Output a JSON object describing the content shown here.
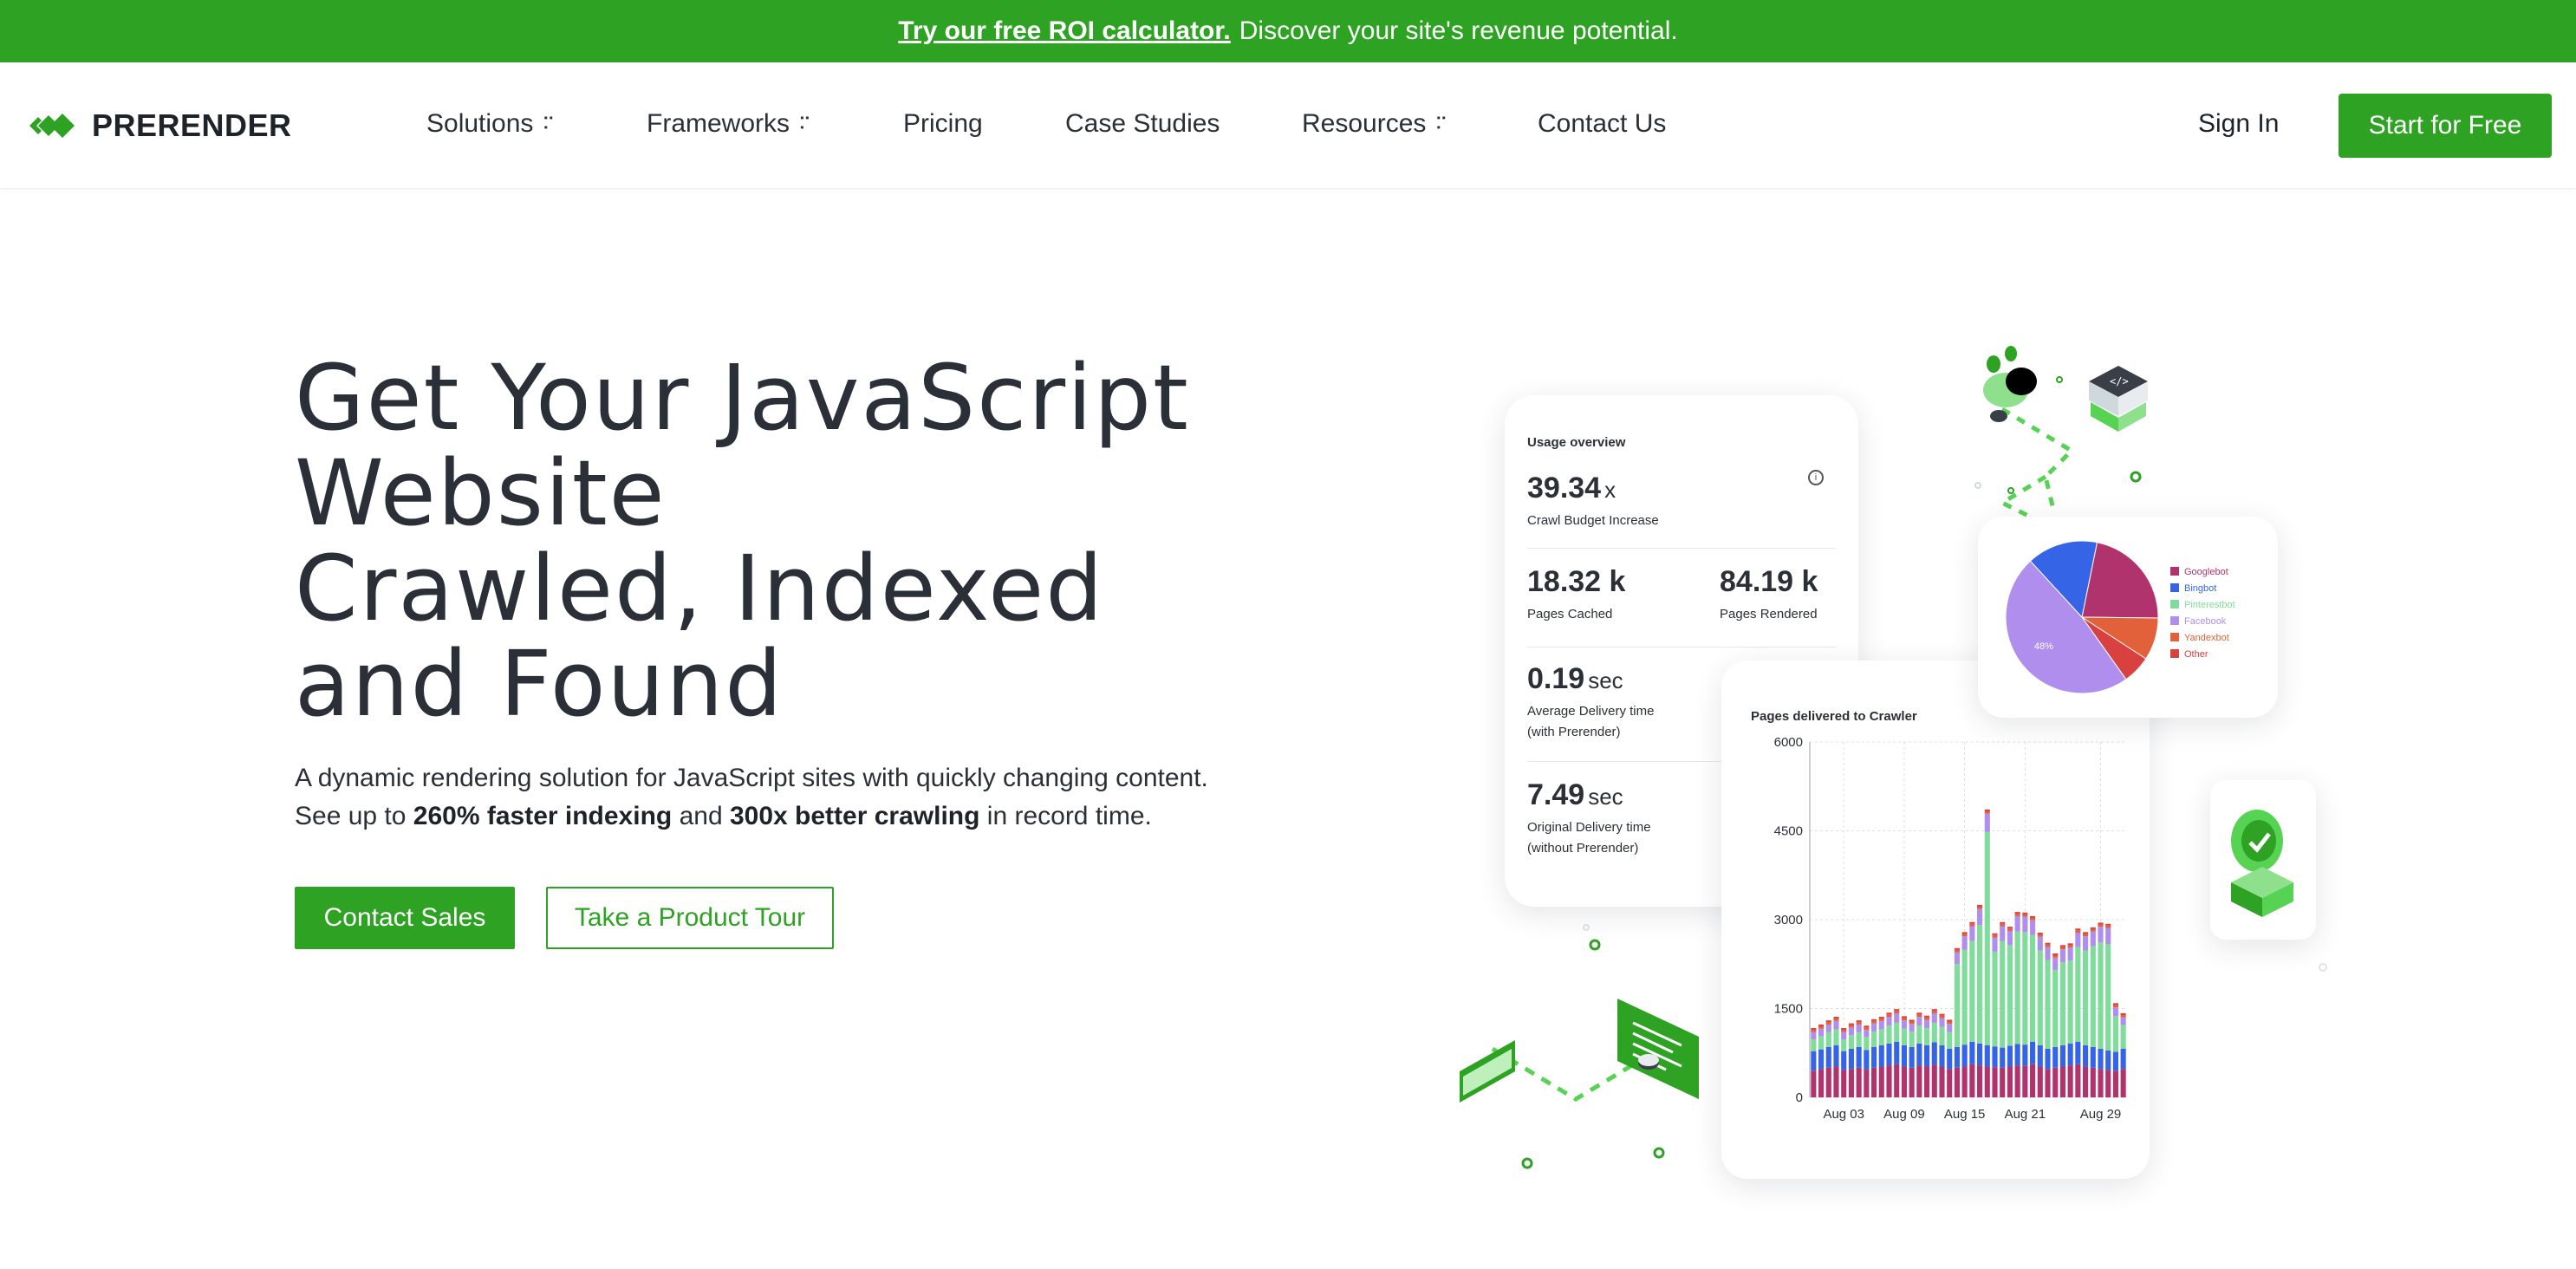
{
  "promo": {
    "link_label": "Try our free ROI calculator.",
    "text": "Discover your site's revenue potential."
  },
  "header": {
    "logo_text": "PRERENDER",
    "nav": [
      {
        "label": "Solutions",
        "dropdown": true
      },
      {
        "label": "Frameworks",
        "dropdown": true
      },
      {
        "label": "Pricing",
        "dropdown": false
      },
      {
        "label": "Case Studies",
        "dropdown": false
      },
      {
        "label": "Resources",
        "dropdown": true
      },
      {
        "label": "Contact Us",
        "dropdown": false
      }
    ],
    "sign_in": "Sign In",
    "cta": "Start for Free"
  },
  "hero": {
    "title_line1": "Get Your JavaScript",
    "title_line2": "Website",
    "title_line3_highlight": "Crawled,",
    "title_line3_rest": " Indexed",
    "title_line4": "and Found",
    "sub_line1": "A dynamic rendering solution for JavaScript sites with quickly changing content.",
    "sub_prefix": "See up to ",
    "sub_bold1": "260% faster indexing",
    "sub_mid": " and ",
    "sub_bold2": "300x better crawling",
    "sub_suffix": " in record time.",
    "btn_primary": "Contact Sales",
    "btn_secondary": "Take a Product Tour"
  },
  "usage_card": {
    "title": "Usage overview",
    "metrics": [
      {
        "value": "39.34",
        "unit": "x",
        "label": "Crawl Budget Increase"
      },
      {
        "value": "18.32 k",
        "unit": "",
        "label": "Pages Cached"
      },
      {
        "value": "84.19 k",
        "unit": "",
        "label": "Pages Rendered"
      },
      {
        "value": "0.19",
        "unit": "sec",
        "label": "Average Delivery time",
        "label2": "(with Prerender)"
      },
      {
        "value": "7.49",
        "unit": "sec",
        "label": "Original Delivery time",
        "label2": "(without Prerender)"
      }
    ]
  },
  "colors": {
    "brand_green": "#2ea222",
    "highlight_green": "#57d354",
    "googlebot": "#b0336d",
    "bingbot": "#3564e6",
    "pinterestbot": "#7fdc9a",
    "facebook": "#b08eee",
    "yandexbot": "#e2603a",
    "other": "#d94040"
  },
  "chart_data": [
    {
      "type": "pie",
      "title": "",
      "slices": [
        {
          "name": "Googlebot",
          "value": 22
        },
        {
          "name": "Bingbot",
          "value": 15
        },
        {
          "name": "Pinterestbot",
          "value": 0
        },
        {
          "name": "Facebook",
          "value": 48,
          "label": "48%"
        },
        {
          "name": "Yandexbot",
          "value": 9
        },
        {
          "name": "Other",
          "value": 6
        }
      ]
    },
    {
      "type": "bar",
      "stacked": true,
      "title": "Pages delivered to Crawler",
      "ylim": [
        0,
        6000
      ],
      "yticks": [
        0,
        1500,
        3000,
        4500,
        6000
      ],
      "xtick_labels": [
        "Aug 03",
        "Aug 09",
        "Aug 15",
        "Aug 21",
        "Aug 29"
      ],
      "grid": true,
      "series": [
        {
          "name": "Googlebot",
          "values": [
            450,
            480,
            500,
            520,
            460,
            480,
            500,
            470,
            500,
            520,
            540,
            560,
            520,
            500,
            540,
            520,
            550,
            520,
            480,
            500,
            520,
            560,
            540,
            520,
            510,
            500,
            520,
            540,
            530,
            560,
            520,
            480,
            500,
            520,
            540,
            560,
            520,
            500,
            480,
            460,
            450,
            480
          ]
        },
        {
          "name": "Bingbot",
          "values": [
            330,
            330,
            350,
            360,
            320,
            340,
            350,
            330,
            350,
            360,
            370,
            380,
            360,
            350,
            370,
            360,
            380,
            360,
            340,
            350,
            370,
            380,
            370,
            360,
            350,
            340,
            350,
            360,
            360,
            380,
            360,
            340,
            350,
            360,
            370,
            380,
            360,
            350,
            340,
            330,
            320,
            340
          ]
        },
        {
          "name": "Pinterestbot",
          "values": [
            200,
            220,
            250,
            270,
            200,
            230,
            250,
            220,
            260,
            270,
            300,
            320,
            280,
            260,
            300,
            290,
            330,
            310,
            280,
            1400,
            1600,
            1700,
            2000,
            3600,
            1600,
            1800,
            1700,
            1900,
            1900,
            1800,
            1600,
            1500,
            1300,
            1400,
            1400,
            1600,
            1600,
            1700,
            1800,
            1800,
            600,
            400
          ]
        },
        {
          "name": "Facebook",
          "values": [
            120,
            130,
            130,
            140,
            120,
            130,
            130,
            120,
            140,
            140,
            150,
            160,
            140,
            130,
            150,
            140,
            160,
            150,
            140,
            200,
            230,
            250,
            270,
            310,
            240,
            250,
            240,
            260,
            260,
            250,
            230,
            220,
            210,
            220,
            220,
            240,
            240,
            250,
            260,
            270,
            150,
            130
          ]
        },
        {
          "name": "Yandexbot",
          "values": [
            40,
            40,
            40,
            40,
            40,
            40,
            40,
            40,
            40,
            40,
            40,
            40,
            40,
            40,
            40,
            40,
            40,
            40,
            40,
            40,
            40,
            40,
            40,
            40,
            40,
            40,
            40,
            40,
            40,
            40,
            40,
            40,
            40,
            40,
            40,
            40,
            40,
            40,
            40,
            40,
            40,
            40
          ]
        },
        {
          "name": "Other",
          "values": [
            30,
            30,
            30,
            30,
            30,
            30,
            30,
            30,
            30,
            30,
            30,
            30,
            30,
            30,
            30,
            30,
            30,
            30,
            30,
            30,
            30,
            30,
            30,
            30,
            30,
            30,
            30,
            30,
            30,
            30,
            30,
            30,
            30,
            30,
            30,
            30,
            30,
            30,
            30,
            30,
            30,
            30
          ]
        }
      ]
    }
  ]
}
